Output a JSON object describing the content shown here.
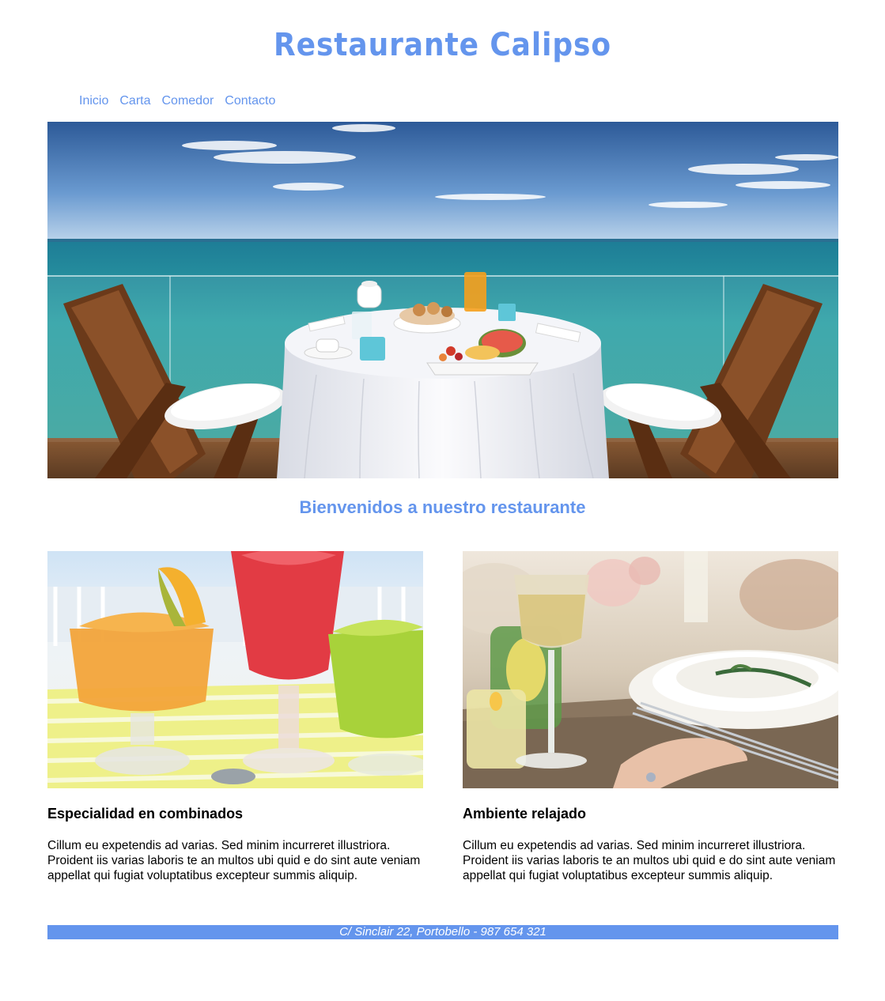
{
  "header": {
    "title": "Restaurante Calipso"
  },
  "nav": {
    "items": [
      "Inicio",
      "Carta",
      "Comedor",
      "Contacto"
    ]
  },
  "hero": {
    "image": "seaside-terrace-table-photo"
  },
  "main": {
    "heading": "Bienvenidos a nuestro restaurante",
    "cards": [
      {
        "image": "slush-drinks-photo",
        "title": "Especialidad en combinados",
        "text": "Cillum eu expetendis ad varias. Sed minim incurreret illustriora. Proident iis varias laboris te an multos ubi quid e do sint aute veniam appellat qui fugiat voluptatibus excepteur summis aliquip."
      },
      {
        "image": "table-setting-wine-photo",
        "title": "Ambiente relajado",
        "text": "Cillum eu expetendis ad varias. Sed minim incurreret illustriora. Proident iis varias laboris te an multos ubi quid e do sint aute veniam appellat qui fugiat voluptatibus excepteur summis aliquip."
      }
    ]
  },
  "footer": {
    "text": "C/ Sinclair 22, Portobello - 987 654 321"
  },
  "colors": {
    "accent": "#6495ed",
    "background": "#ffffff",
    "text": "#000000"
  }
}
